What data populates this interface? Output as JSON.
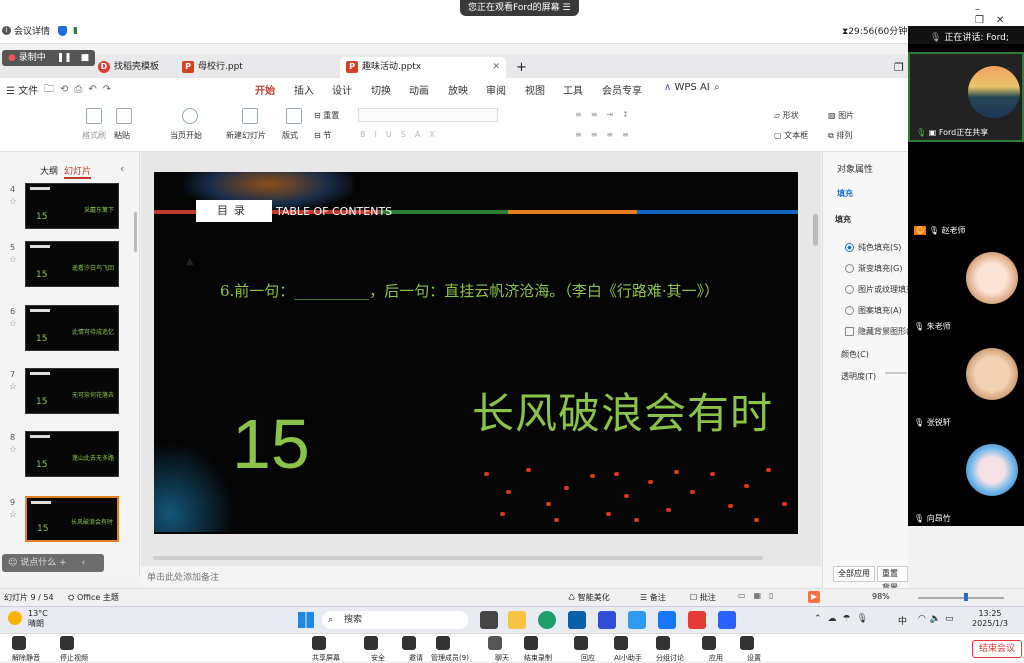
{
  "meeting": {
    "share_banner": "您正在观看Ford的屏幕",
    "details_label": "会议详情",
    "timer": "29:56(60分钟)",
    "speaking": "正在讲话:  Ford;",
    "recording": "录制中",
    "end_button": "结束会议",
    "participants": [
      {
        "name": "Ford正在共享"
      },
      {
        "name": "赵老师"
      },
      {
        "name": "朱老师"
      },
      {
        "name": "张锐轩"
      },
      {
        "name": "向昂竹"
      }
    ],
    "toolbar": [
      {
        "label": "解除静音",
        "icon": "mic-icon"
      },
      {
        "label": "停止视频",
        "icon": "camera-icon"
      },
      {
        "label": "共享屏幕",
        "icon": "share-screen-icon"
      },
      {
        "label": "安全",
        "icon": "shield-icon"
      },
      {
        "label": "邀请",
        "icon": "invite-icon"
      },
      {
        "label": "管理成员(9)",
        "icon": "members-icon"
      },
      {
        "label": "聊天",
        "icon": "chat-icon"
      },
      {
        "label": "结束录制",
        "icon": "record-icon"
      },
      {
        "label": "回应",
        "icon": "react-icon"
      },
      {
        "label": "AI小助手",
        "icon": "ai-icon"
      },
      {
        "label": "分组讨论",
        "icon": "group-icon"
      },
      {
        "label": "应用",
        "icon": "apps-icon"
      },
      {
        "label": "设置",
        "icon": "gear-icon"
      }
    ]
  },
  "wps": {
    "tabs": [
      {
        "label": "找稻壳模板"
      },
      {
        "label": "母校行.ppt"
      },
      {
        "label": "趣味活动.pptx"
      }
    ],
    "file_menu": "文件",
    "menu": [
      "开始",
      "插入",
      "设计",
      "切换",
      "动画",
      "放映",
      "审阅",
      "视图",
      "工具",
      "会员专享",
      "WPS AI"
    ],
    "ribbon": {
      "format_painter": "格式刷",
      "paste": "粘贴",
      "play_from_current": "当页开始",
      "new_slide": "新建幻灯片",
      "layout": "版式",
      "reset": "重置",
      "section": "节",
      "shape": "形状",
      "picture": "图片",
      "textbox": "文本框",
      "arrange": "排列"
    },
    "panel_tabs": {
      "outline": "大纲",
      "slides": "幻灯片"
    },
    "thumbnails": [
      {
        "num": "4",
        "caption": "采蘑东篱下"
      },
      {
        "num": "5",
        "caption": "遥看汐白鸟飞回"
      },
      {
        "num": "6",
        "caption": "此情可待成追忆"
      },
      {
        "num": "7",
        "caption": "无可奈何花落去"
      },
      {
        "num": "8",
        "caption": "蓬山此去无多路"
      },
      {
        "num": "9",
        "caption": "长风破浪会有时"
      }
    ],
    "slide": {
      "header_label": "目录",
      "header_en": "TABLE OF CONTENTS",
      "question": "6.前一句：__________，后一句：直挂云帆济沧海。（李白《行路难·其一》）",
      "number": "15",
      "title": "长风破浪会有时"
    },
    "notes_placeholder": "单击此处添加备注",
    "comment_placeholder": "说点什么",
    "props": {
      "title": "对象属性",
      "fill_tab": "填充",
      "fill_section": "填充",
      "options": [
        "纯色填充(S)",
        "渐变填充(G)",
        "图片或纹理填充",
        "图案填充(A)",
        "隐藏背景图形(H)"
      ],
      "color_label": "颜色(C)",
      "transparency_label": "透明度(T)",
      "apply_all": "全部应用",
      "reset_bg": "重置背景"
    },
    "status": {
      "slide_pos": "幻灯片 9 / 54",
      "theme": "Office 主题",
      "smart_beautify": "智能美化",
      "notes": "备注",
      "comments": "批注",
      "zoom": "98%"
    }
  },
  "taskbar": {
    "weather_temp": "13°C",
    "weather_desc": "晴朗",
    "search": "搜索",
    "time": "13:25",
    "date": "2025/1/3",
    "ime": "中"
  }
}
